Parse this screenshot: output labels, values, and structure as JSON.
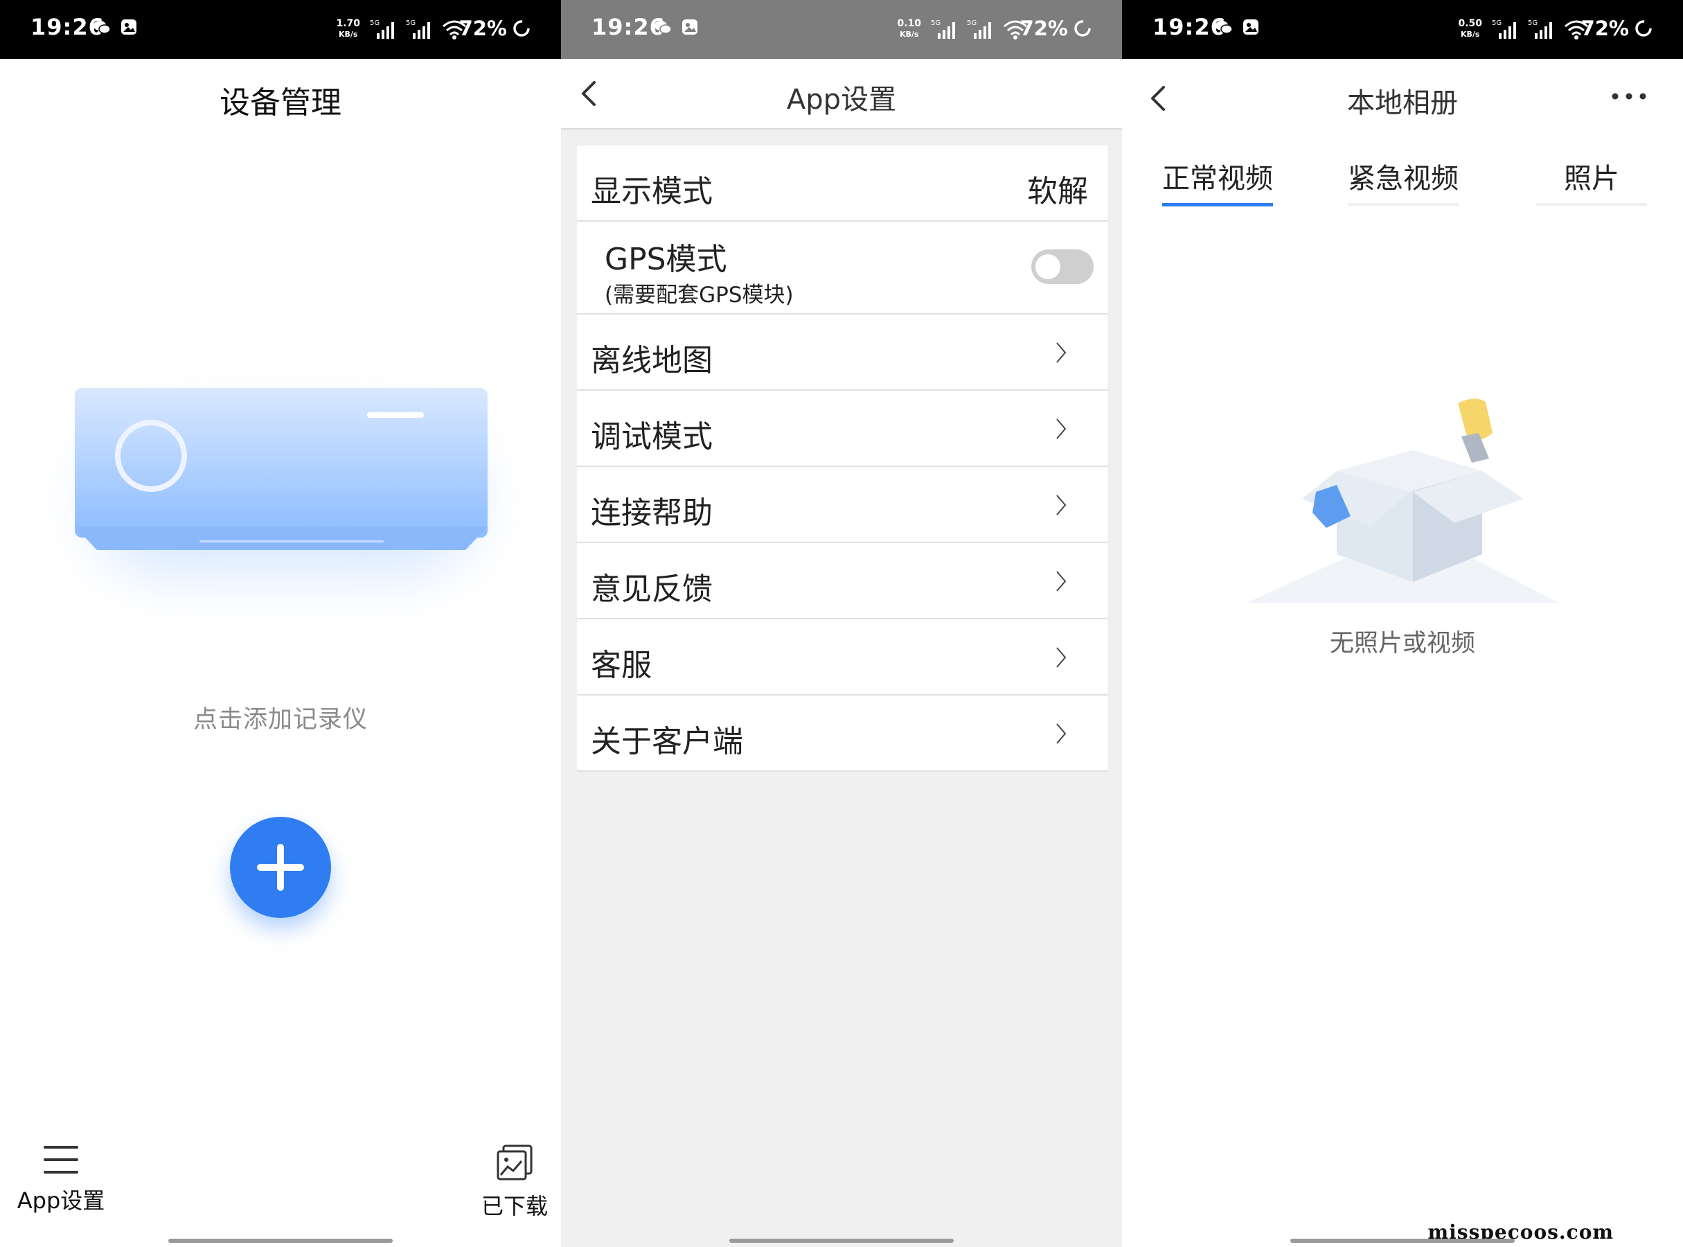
{
  "status_bar": {
    "time": "19:26",
    "battery": "72%",
    "speed_unit": "KB/s",
    "net_label": "5G",
    "speeds": [
      "1.70",
      "0.10",
      "0.50"
    ]
  },
  "device_screen": {
    "title": "设备管理",
    "hint": "点击添加记录仪",
    "nav": {
      "settings_label": "App设置",
      "downloads_label": "已下载"
    }
  },
  "settings_screen": {
    "title": "App设置",
    "display_mode": {
      "label": "显示模式",
      "value": "软解"
    },
    "gps": {
      "label": "GPS模式",
      "sublabel": "(需要配套GPS模块)",
      "enabled": false
    },
    "items": [
      {
        "label": "离线地图"
      },
      {
        "label": "调试模式"
      },
      {
        "label": "连接帮助"
      },
      {
        "label": "意见反馈"
      },
      {
        "label": "客服"
      },
      {
        "label": "关于客户端"
      }
    ]
  },
  "album_screen": {
    "title": "本地相册",
    "tabs": [
      {
        "label": "正常视频",
        "active": true
      },
      {
        "label": "紧急视频",
        "active": false
      },
      {
        "label": "照片",
        "active": false
      }
    ],
    "empty_text": "无照片或视频"
  },
  "watermark": "misspecoos.com",
  "colors": {
    "accent": "#2f7df1",
    "settings_bg": "#f0f0f0",
    "ac_blue": "#a9ccff"
  }
}
